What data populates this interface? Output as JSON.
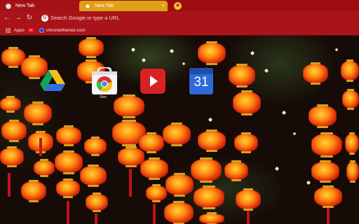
{
  "tabs": [
    {
      "label": "New Tab",
      "active": false
    },
    {
      "label": "New Tab",
      "active": true
    }
  ],
  "tabstrip": {
    "close_glyph": "×",
    "new_tab_glyph": "+"
  },
  "toolbar": {
    "back_glyph": "←",
    "forward_glyph": "→",
    "reload_glyph": "↻",
    "omnibox_placeholder": "Search Google or type a URL"
  },
  "bookmarks": [
    {
      "label": "Apps",
      "icon": "apps-grid-icon"
    },
    {
      "label": "",
      "icon": "youtube-icon"
    },
    {
      "label": "chromethemer.com",
      "icon": "chromethemer-icon"
    }
  ],
  "tiles": [
    {
      "name": "google-drive",
      "label": ""
    },
    {
      "name": "chrome-web-store",
      "label": "Stor"
    },
    {
      "name": "youtube",
      "label": ""
    },
    {
      "name": "google-calendar",
      "label": "",
      "calendar_day": "31"
    }
  ],
  "colors": {
    "tabstrip": "#9c0c10",
    "active_tab": "#e0a018",
    "toolbar": "#a81419"
  }
}
